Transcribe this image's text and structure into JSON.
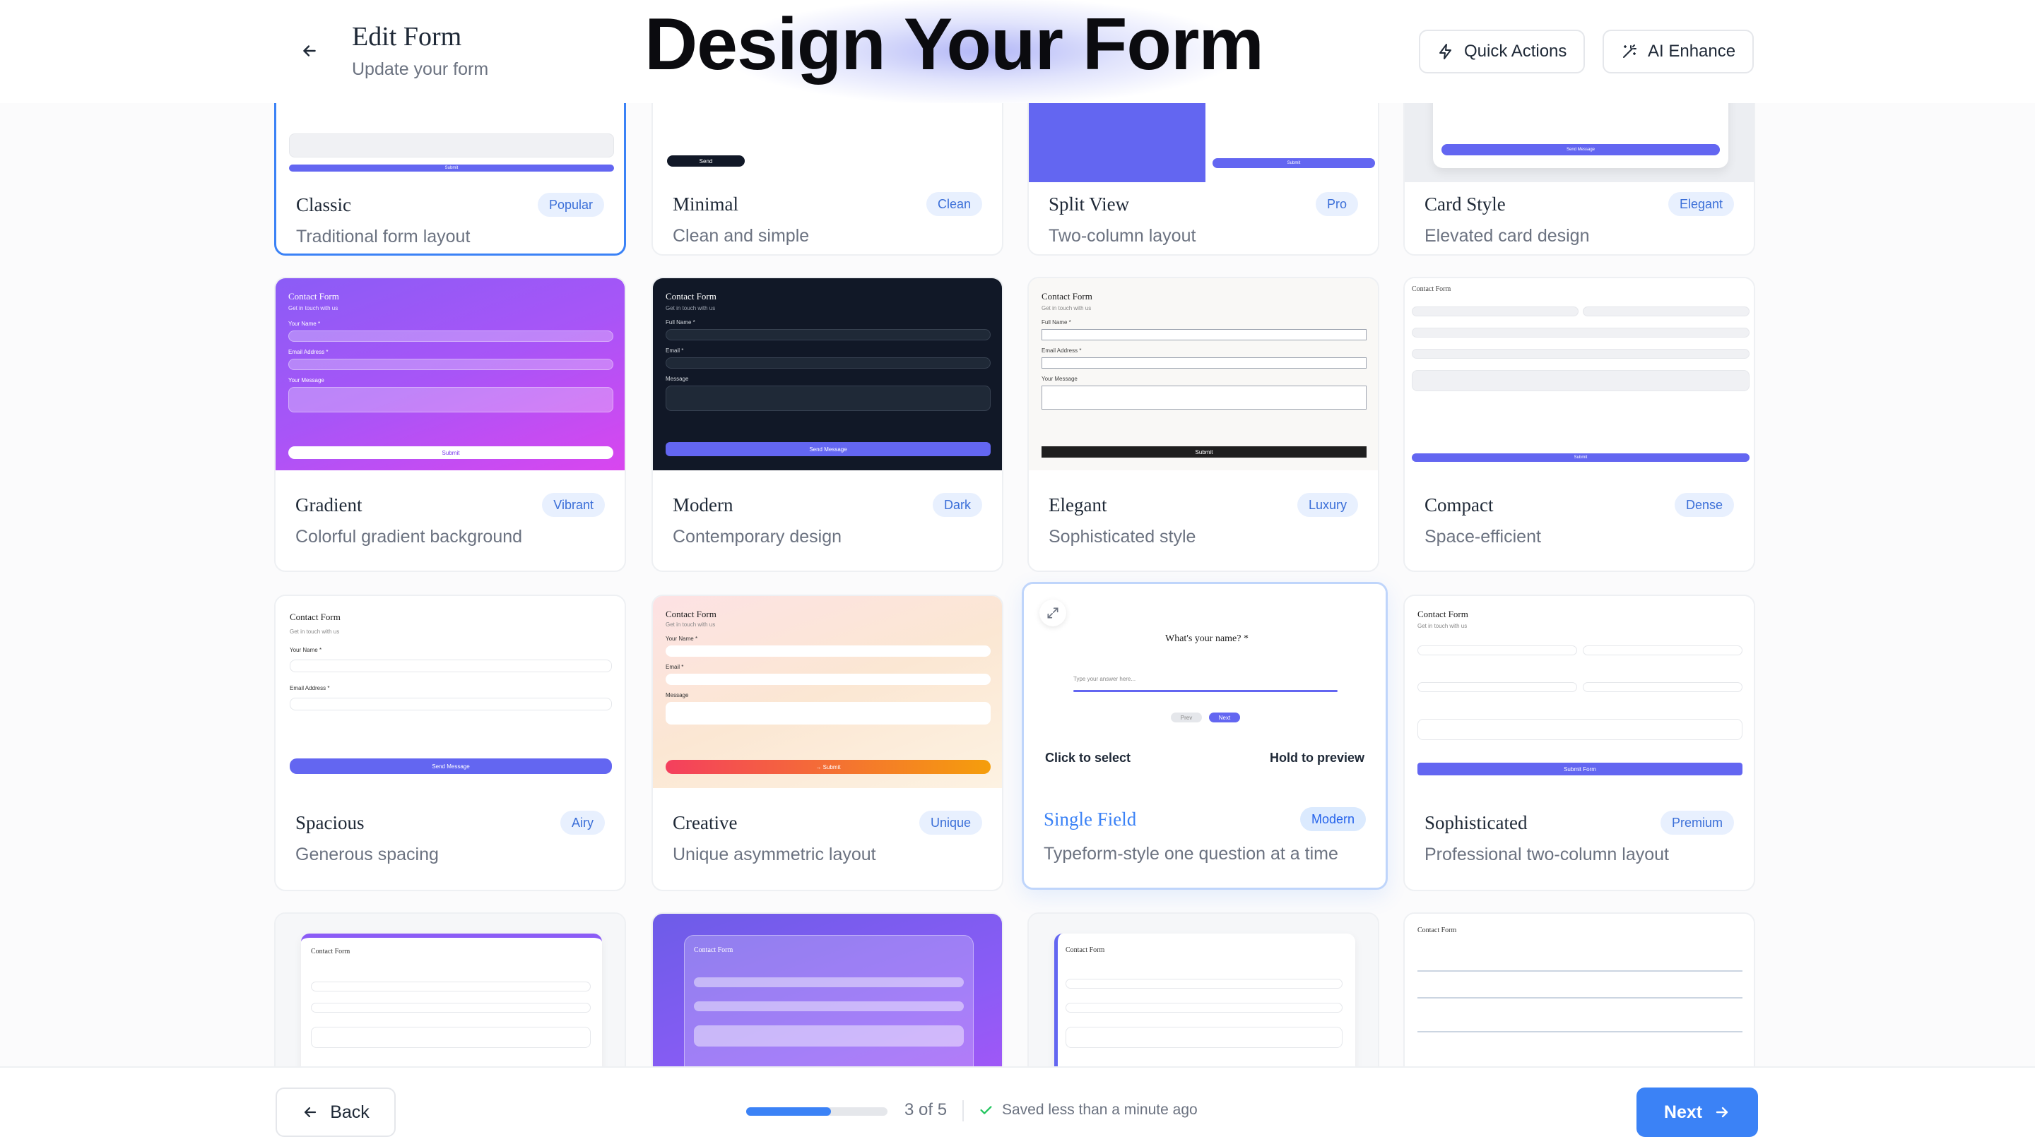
{
  "header": {
    "title": "Edit Form",
    "subtitle": "Update your form",
    "banner": "Design Your Form",
    "quick_actions": "Quick Actions",
    "ai_enhance": "AI Enhance"
  },
  "templates": [
    {
      "name": "Classic",
      "badge": "Popular",
      "desc": "Traditional form layout",
      "selected": true
    },
    {
      "name": "Minimal",
      "badge": "Clean",
      "desc": "Clean and simple"
    },
    {
      "name": "Split View",
      "badge": "Pro",
      "desc": "Two-column layout"
    },
    {
      "name": "Card Style",
      "badge": "Elegant",
      "desc": "Elevated card design"
    },
    {
      "name": "Gradient",
      "badge": "Vibrant",
      "desc": "Colorful gradient background"
    },
    {
      "name": "Modern",
      "badge": "Dark",
      "desc": "Contemporary design"
    },
    {
      "name": "Elegant",
      "badge": "Luxury",
      "desc": "Sophisticated style"
    },
    {
      "name": "Compact",
      "badge": "Dense",
      "desc": "Space-efficient"
    },
    {
      "name": "Spacious",
      "badge": "Airy",
      "desc": "Generous spacing"
    },
    {
      "name": "Creative",
      "badge": "Unique",
      "desc": "Unique asymmetric layout"
    },
    {
      "name": "Single Field",
      "badge": "Modern",
      "desc": "Typeform-style one question at a time",
      "hover": true
    },
    {
      "name": "Sophisticated",
      "badge": "Premium",
      "desc": "Professional two-column layout"
    }
  ],
  "preview_text": {
    "contact_form": "Contact Form",
    "get_in_touch": "Get in touch with us",
    "your_name": "Your Name *",
    "full_name": "Full Name *",
    "email_address": "Email Address *",
    "email": "Email *",
    "your_message": "Your Message",
    "message": "Message",
    "submit": "Submit",
    "send": "Send",
    "send_message": "Send Message",
    "submit_form": "Submit Form",
    "creative_submit": "→ Submit",
    "question": "What's your name? *",
    "answer_placeholder": "Type your answer here...",
    "prev": "Prev",
    "next": "Next"
  },
  "hover_overlay": {
    "click": "Click to select",
    "hold": "Hold to preview"
  },
  "footer": {
    "back": "Back",
    "step": "3 of 5",
    "progress": 0.6,
    "saved": "Saved less than a minute ago",
    "next": "Next"
  },
  "colors": {
    "accent": "#3b82f6",
    "indigo": "#6366f1",
    "dark": "#111827"
  }
}
